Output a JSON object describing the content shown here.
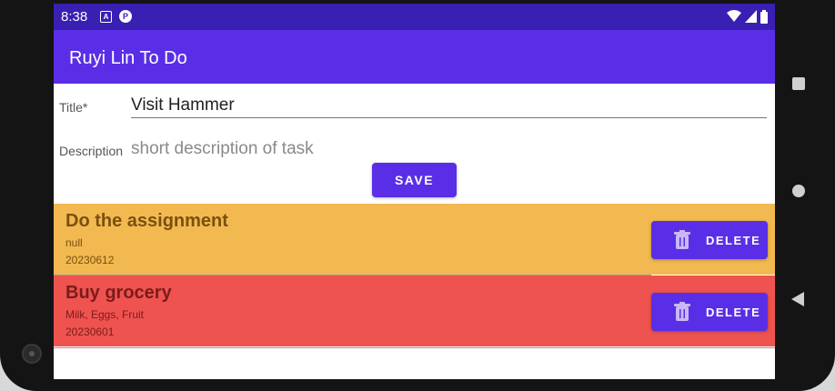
{
  "status_bar": {
    "time": "8:38",
    "icon_a": "A",
    "icon_p": "P",
    "icons": [
      "wifi-icon",
      "signal-icon",
      "battery-icon"
    ]
  },
  "app_bar": {
    "title": "Ruyi Lin To Do"
  },
  "form": {
    "title_label": "Title*",
    "title_value": "Visit Hammer",
    "description_label": "Description",
    "description_placeholder": "short description of task",
    "save_label": "SAVE"
  },
  "tasks": [
    {
      "title": "Do the assignment",
      "description": "null",
      "date": "20230612",
      "delete_label": "DELETE",
      "bg_color": "#f2b950",
      "text_color": "#7a5010"
    },
    {
      "title": "Buy grocery",
      "description": "Milk, Eggs, Fruit",
      "date": "20230601",
      "delete_label": "DELETE",
      "bg_color": "#ef5350",
      "text_color": "#7a1c1a"
    }
  ],
  "colors": {
    "status_bar": "#3a1fb3",
    "app_bar": "#5a2ee6",
    "accent": "#5a2ee6"
  },
  "nav_buttons": [
    "recents-button",
    "home-button",
    "back-button"
  ]
}
